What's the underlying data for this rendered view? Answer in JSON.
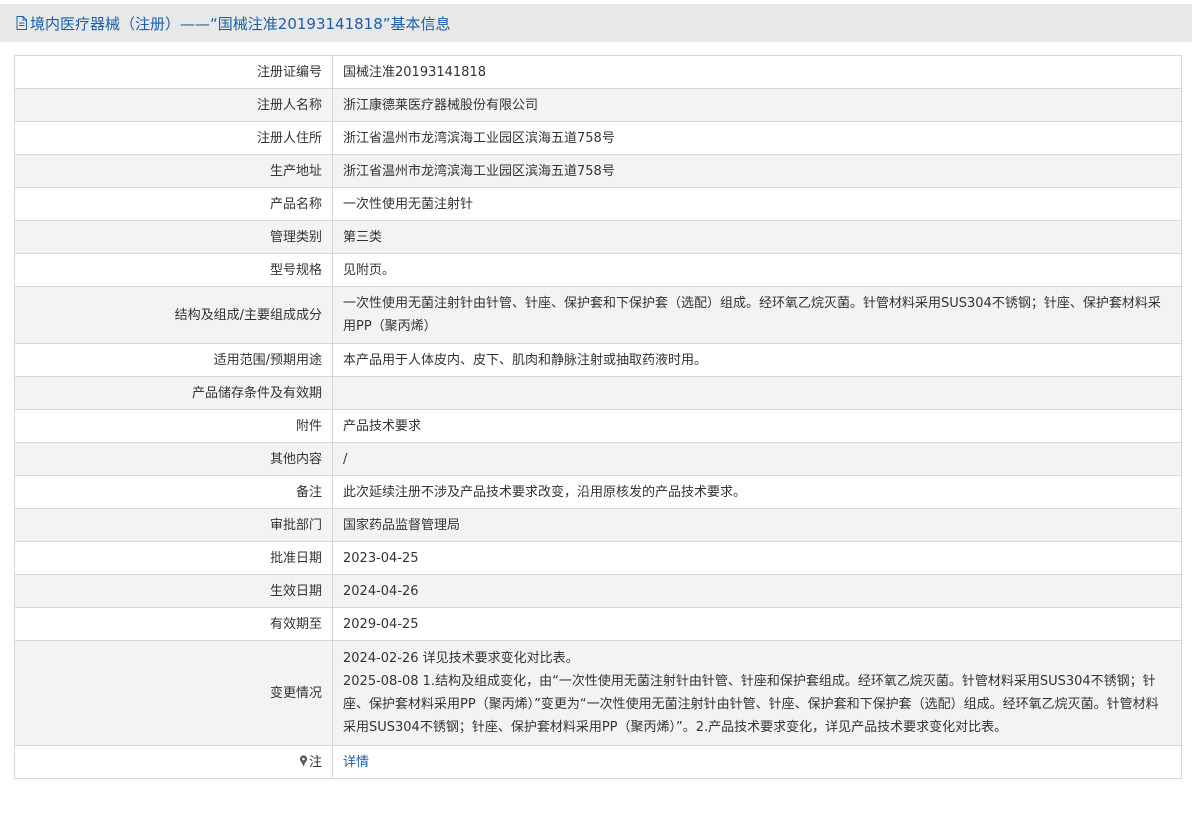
{
  "header": {
    "title": "境内医疗器械（注册）——“国械注准20193141818”基本信息",
    "icon": "document-icon"
  },
  "rows": {
    "reg_no": {
      "label": "注册证编号",
      "value": "国械注准20193141818"
    },
    "registrant": {
      "label": "注册人名称",
      "value": "浙江康德莱医疗器械股份有限公司"
    },
    "registrant_address": {
      "label": "注册人住所",
      "value": "浙江省温州市龙湾滨海工业园区滨海五道758号"
    },
    "production_address": {
      "label": "生产地址",
      "value": "浙江省温州市龙湾滨海工业园区滨海五道758号"
    },
    "product_name": {
      "label": "产品名称",
      "value": "一次性使用无菌注射针"
    },
    "category": {
      "label": "管理类别",
      "value": "第三类"
    },
    "model": {
      "label": "型号规格",
      "value": "见附页。"
    },
    "structure": {
      "label": "结构及组成/主要组成成分",
      "value": "一次性使用无菌注射针由针管、针座、保护套和下保护套（选配）组成。经环氧乙烷灭菌。针管材料采用SUS304不锈钢；针座、保护套材料采用PP（聚丙烯）"
    },
    "usage": {
      "label": "适用范围/预期用途",
      "value": "本产品用于人体皮内、皮下、肌肉和静脉注射或抽取药液时用。"
    },
    "storage": {
      "label": "产品储存条件及有效期",
      "value": ""
    },
    "attachment": {
      "label": "附件",
      "value": "产品技术要求"
    },
    "other": {
      "label": "其他内容",
      "value": "/"
    },
    "remark": {
      "label": "备注",
      "value": "此次延续注册不涉及产品技术要求改变，沿用原核发的产品技术要求。"
    },
    "approval_dept": {
      "label": "审批部门",
      "value": "国家药品监督管理局"
    },
    "approval_date": {
      "label": "批准日期",
      "value": "2023-04-25"
    },
    "effective_date": {
      "label": "生效日期",
      "value": "2024-04-26"
    },
    "expiry_date": {
      "label": "有效期至",
      "value": "2029-04-25"
    },
    "changes": {
      "label": "变更情况",
      "lines": [
        "2024-02-26 详见技术要求变化对比表。",
        "2025-08-08 1.结构及组成变化，由“一次性使用无菌注射针由针管、针座和保护套组成。经环氧乙烷灭菌。针管材料采用SUS304不锈钢；针座、保护套材料采用PP（聚丙烯）”变更为“一次性使用无菌注射针由针管、针座、保护套和下保护套（选配）组成。经环氧乙烷灭菌。针管材料采用SUS304不锈钢；针座、保护套材料采用PP（聚丙烯）”。2.产品技术要求变化，详见产品技术要求变化对比表。"
      ]
    },
    "note": {
      "label": "注",
      "icon": "pin-icon",
      "link": "详情"
    }
  },
  "colors": {
    "title_bg": "#e8e8e8",
    "title_text": "#1b5fa8",
    "row_alt_bg": "#f3f3f3",
    "border": "#d6d6d6",
    "link": "#1b5fa8"
  }
}
